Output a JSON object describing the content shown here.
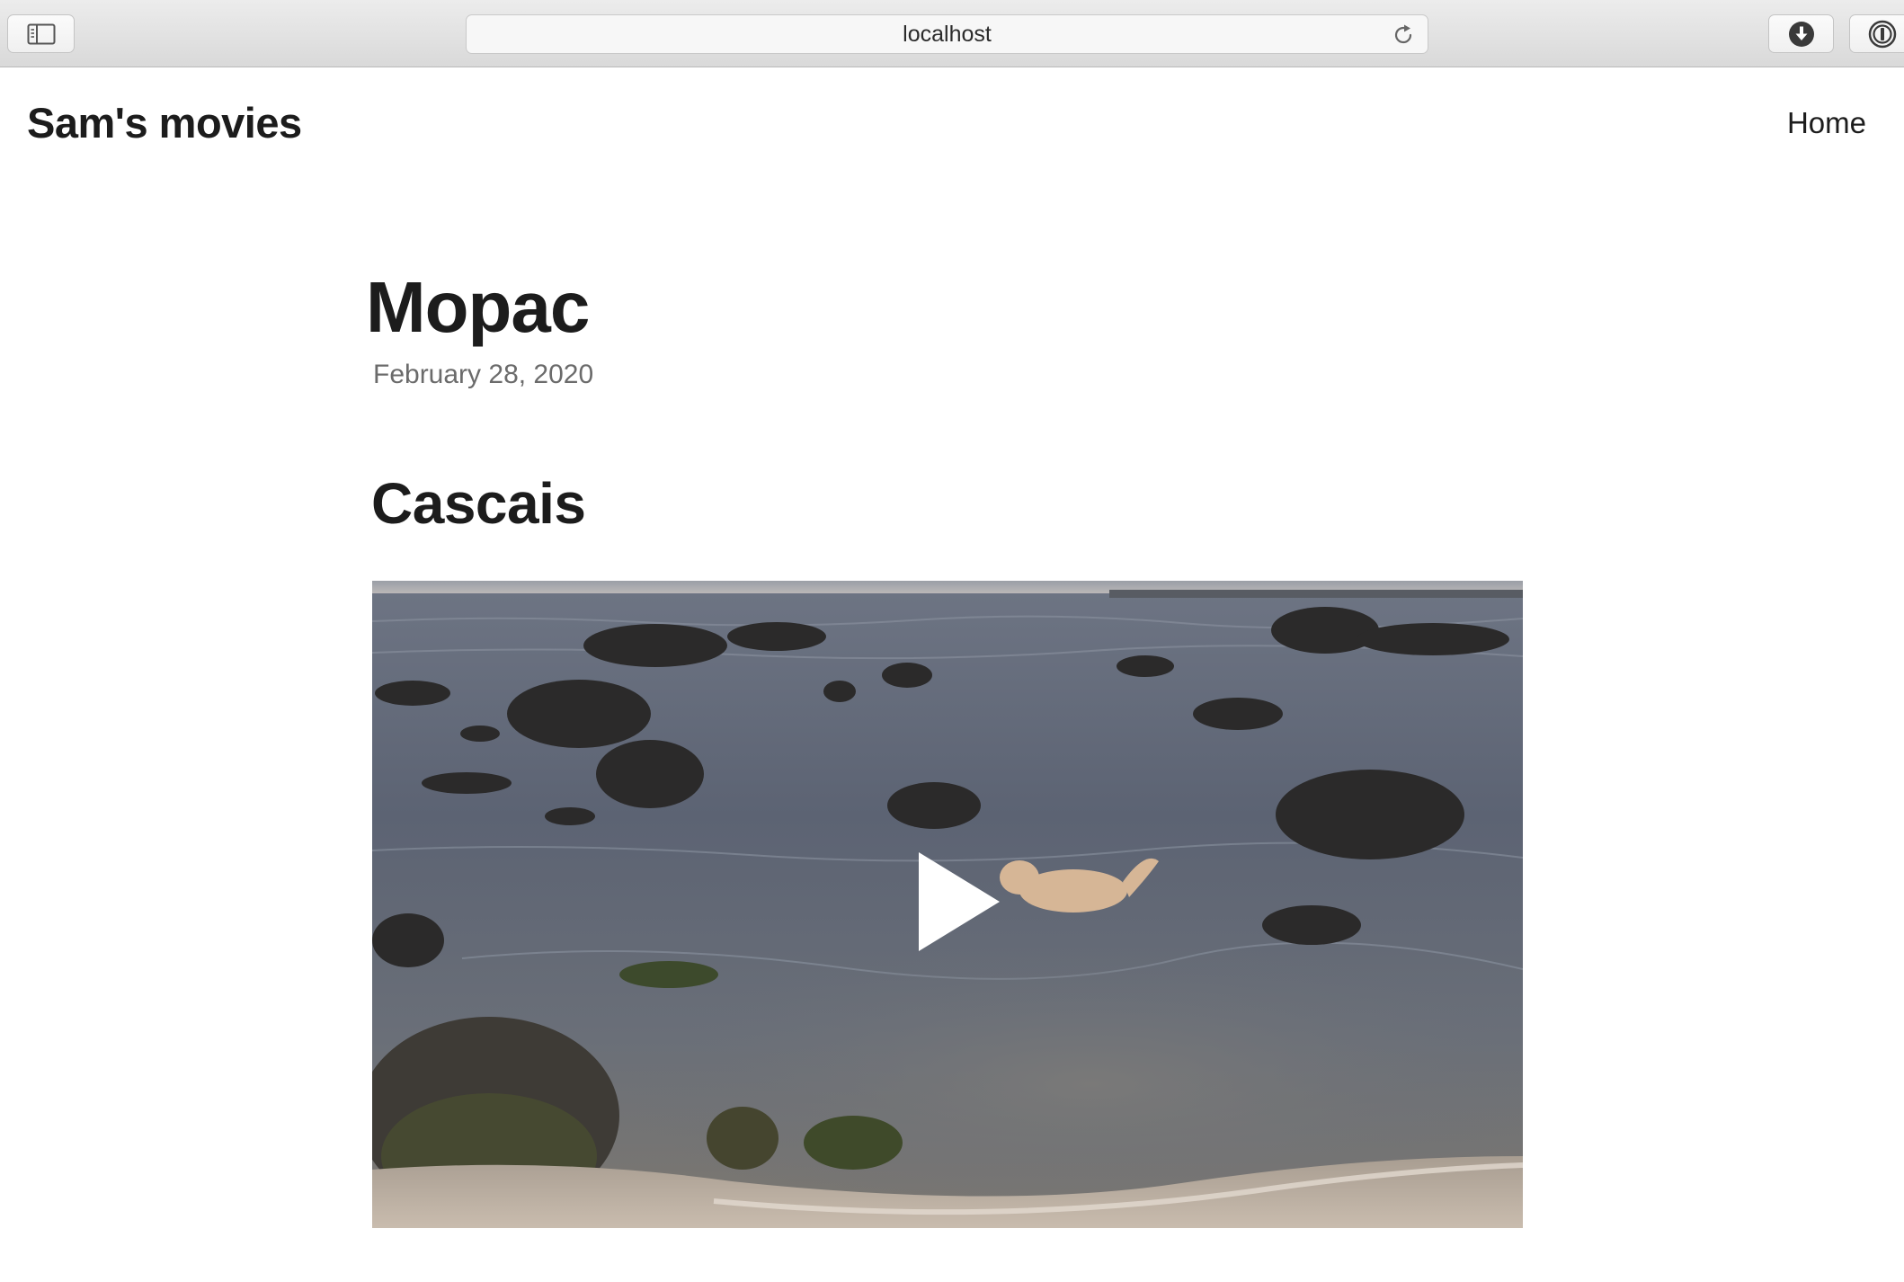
{
  "browser": {
    "address": "localhost"
  },
  "site": {
    "title": "Sam's movies",
    "nav": [
      {
        "label": "Home"
      }
    ]
  },
  "post": {
    "title": "Mopac",
    "date": "February 28, 2020",
    "sections": [
      {
        "heading": "Cascais",
        "video": {
          "poster_description": "",
          "state": "paused"
        }
      }
    ]
  },
  "icons": {
    "sidebar": "sidebar-icon",
    "reload": "reload-icon",
    "download": "download-icon",
    "password": "password-manager-icon",
    "play": "play-icon"
  }
}
